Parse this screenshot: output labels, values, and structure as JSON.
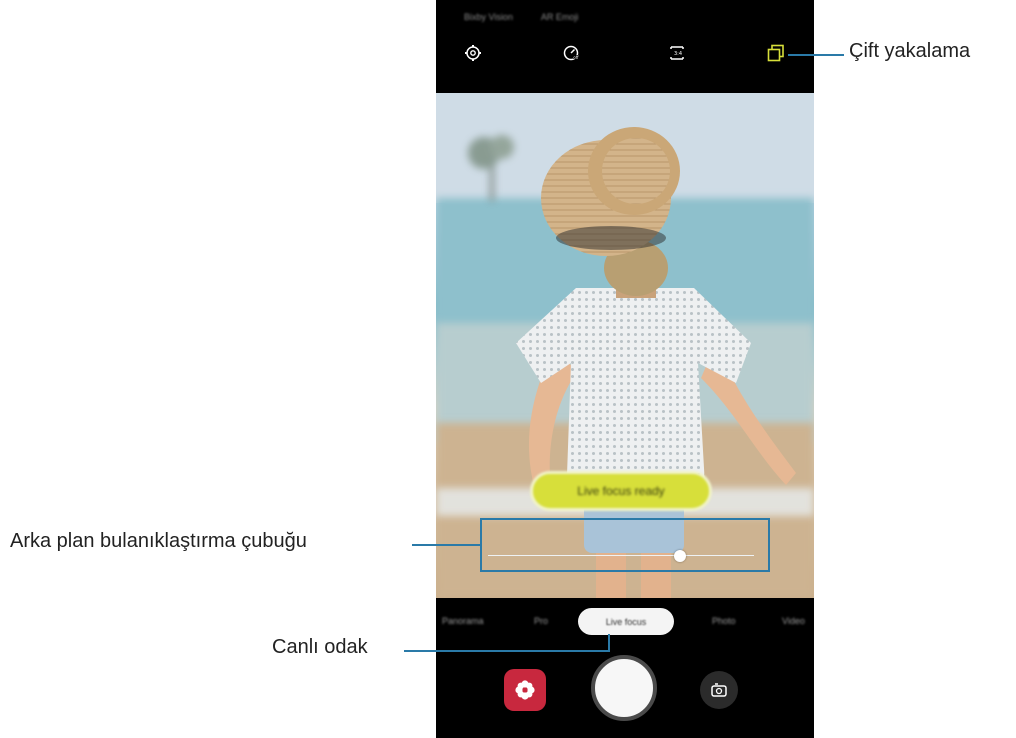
{
  "callouts": {
    "dual_capture": "Çift yakalama",
    "background_blur_bar": "Arka plan bulanıklaştırma çubuğu",
    "live_focus": "Canlı odak"
  },
  "phone": {
    "top_labels": [
      "Bixby Vision",
      "AR Emoji"
    ],
    "top_icons": [
      "settings-icon",
      "timer-icon",
      "aspect-ratio-icon",
      "dual-capture-icon"
    ],
    "live_focus_pill": "Live focus ready",
    "blur_level": 0.72,
    "modes": [
      "Panorama",
      "Pro",
      "Live focus",
      "Photo",
      "Video"
    ],
    "selected_mode": "Live focus",
    "accent_color": "#d7df3a",
    "callout_color": "#2a7aa8"
  }
}
